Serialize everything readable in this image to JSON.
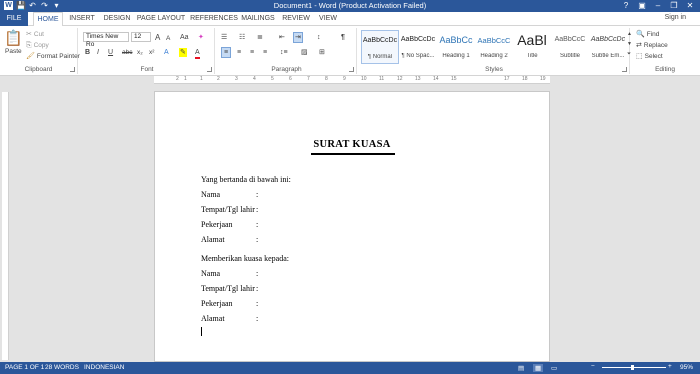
{
  "window": {
    "title": "Document1 - Word (Product Activation Failed)",
    "help": "?",
    "minimize": "–",
    "restore": "❐",
    "close": "✕"
  },
  "qat": [
    "💾",
    "↶",
    "↷",
    "▾"
  ],
  "tabs": [
    "FILE",
    "HOME",
    "INSERT",
    "DESIGN",
    "PAGE LAYOUT",
    "REFERENCES",
    "MAILINGS",
    "REVIEW",
    "VIEW"
  ],
  "signin": "Sign in",
  "clipboard": {
    "paste": "Paste",
    "cut": "Cut",
    "copy": "Copy",
    "format_painter": "Format Painter",
    "label": "Clipboard"
  },
  "font": {
    "name": "Times New Ro",
    "size": "12",
    "grow": "A",
    "shrink": "A",
    "case": "Aa",
    "clear": "✦",
    "bold": "B",
    "italic": "I",
    "underline": "U",
    "strike": "abc",
    "sub": "x₂",
    "sup": "x²",
    "effects": "A",
    "highlight": "✎",
    "color": "A",
    "label": "Font"
  },
  "paragraph": {
    "bullets": "☰",
    "numbering": "☷",
    "multilevel": "≣",
    "decrease": "⇤",
    "increase": "⇥",
    "sort": "↕",
    "show": "¶",
    "align_left": "≡",
    "center": "≡",
    "align_right": "≡",
    "justify": "≡",
    "spacing": "↕≡",
    "shading": "▨",
    "borders": "⊞",
    "label": "Paragraph"
  },
  "styles": {
    "items": [
      {
        "sample": "AaBbCcDc",
        "name": "¶ Normal"
      },
      {
        "sample": "AaBbCcDc",
        "name": "¶ No Spac..."
      },
      {
        "sample": "AaBbCc",
        "name": "Heading 1"
      },
      {
        "sample": "AaBbCcC",
        "name": "Heading 2"
      },
      {
        "sample": "AaBl",
        "name": "Title"
      },
      {
        "sample": "AaBbCcC",
        "name": "Subtitle"
      },
      {
        "sample": "AaBbCcDc",
        "name": "Subtle Em..."
      }
    ],
    "label": "Styles"
  },
  "editing": {
    "find": "Find",
    "replace": "Replace",
    "select": "Select",
    "label": "Editing"
  },
  "ruler": [
    "2",
    "1",
    "1",
    "2",
    "3",
    "4",
    "5",
    "6",
    "7",
    "8",
    "9",
    "10",
    "11",
    "12",
    "13",
    "14",
    "15",
    "17",
    "18",
    "19"
  ],
  "document": {
    "title": "SURAT KUASA",
    "intro": "Yang bertanda di bawah ini:",
    "fields1": [
      "Nama",
      "Tempat/Tgl lahir",
      "Pekerjaan",
      "Alamat"
    ],
    "middle": "Memberikan kuasa kepada:",
    "fields2": [
      "Nama",
      "Tempat/Tgl lahir",
      "Pekerjaan",
      "Alamat"
    ],
    "colon": ":"
  },
  "status": {
    "page": "PAGE 1 OF 1",
    "words": "28 WORDS",
    "language": "INDONESIAN",
    "zoom": "95%",
    "zoom_value": 0.95
  }
}
